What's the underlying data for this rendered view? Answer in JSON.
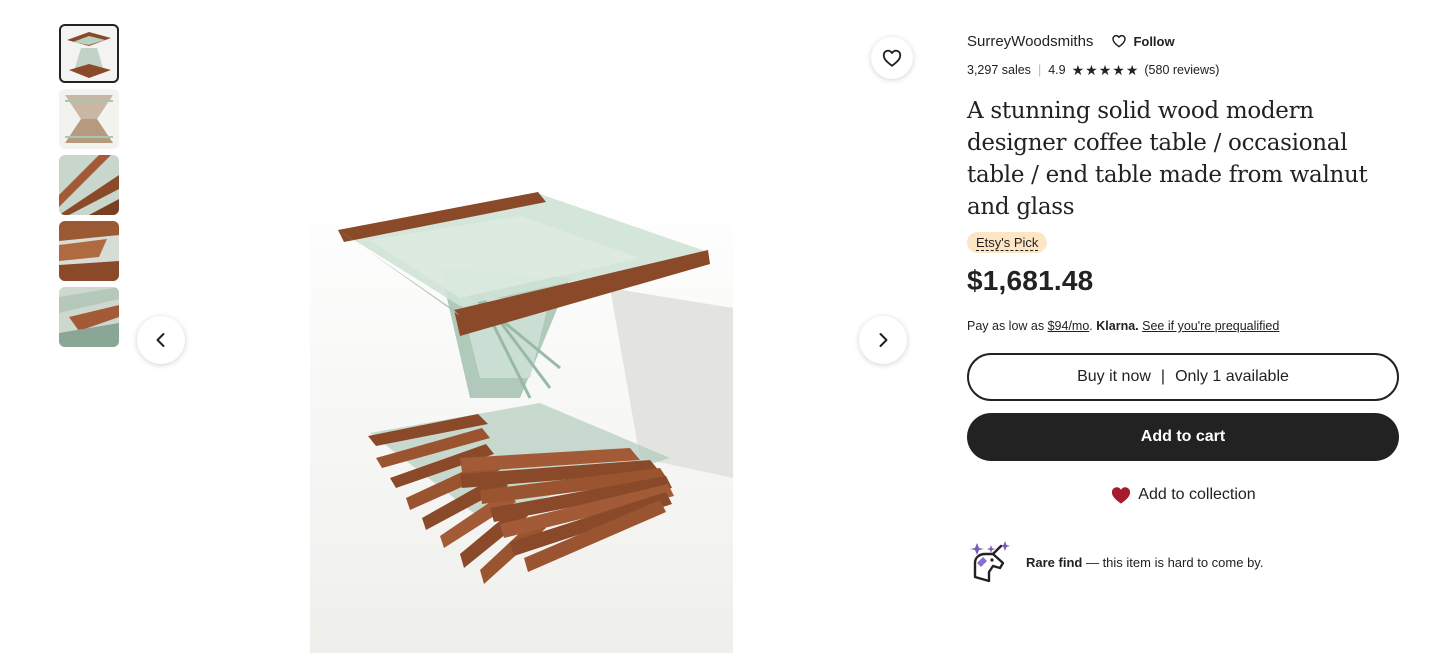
{
  "gallery": {
    "thumbnails": [
      "thumb-1",
      "thumb-2",
      "thumb-3",
      "thumb-4",
      "thumb-5"
    ],
    "active_index": 0
  },
  "icons": {
    "favorite": "heart-outline-icon",
    "prev": "chevron-left-icon",
    "next": "chevron-right-icon",
    "follow": "heart-outline-icon",
    "collection": "heart-filled-icon",
    "rare": "unicorn-icon"
  },
  "shop": {
    "name": "SurreyWoodsmiths",
    "follow_label": "Follow",
    "sales": "3,297 sales",
    "rating": "4.9",
    "rating_value": 5,
    "reviews": "(580 reviews)"
  },
  "product": {
    "title": "A stunning solid wood modern designer coffee table / occasional table / end table made from walnut and glass",
    "badge": "Etsy's Pick",
    "price": "$1,681.48"
  },
  "klarna": {
    "prefix": "Pay as low as ",
    "amount": "$94/mo",
    "dot": ".",
    "brand": "Klarna.",
    "link": "See if you're prequalified"
  },
  "actions": {
    "buy_now": "Buy it now",
    "separator": "|",
    "availability": "Only 1 available",
    "add_to_cart": "Add to cart",
    "add_to_collection": "Add to collection"
  },
  "rare": {
    "strong": "Rare find",
    "text": " — this item is hard to come by."
  },
  "colors": {
    "primary": "#222222",
    "badge_bg": "#fde6c4",
    "heart": "#a61a2e",
    "walnut": "#8a4a2a",
    "glass": "#a9c5b4"
  }
}
